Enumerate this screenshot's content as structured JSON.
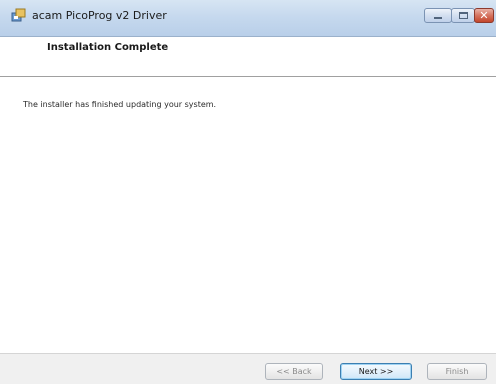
{
  "window": {
    "title": "acam PicoProg v2 Driver",
    "caption_buttons": {
      "minimize_icon": "minimize-icon",
      "maximize_icon": "maximize-icon",
      "close_icon": "close-icon",
      "close_glyph": "✕"
    }
  },
  "header": {
    "title": "Installation Complete"
  },
  "body": {
    "message": "The installer has finished updating your system."
  },
  "footer": {
    "back_label": "<< Back",
    "next_label": "Next >>",
    "finish_label": "Finish",
    "back_enabled": false,
    "next_enabled": true,
    "finish_enabled": false
  },
  "colors": {
    "titlebar": "#c6d9ee",
    "close_button": "#c3452b",
    "default_button_border": "#3c7fb1",
    "disabled_text": "#8a8a8a"
  }
}
